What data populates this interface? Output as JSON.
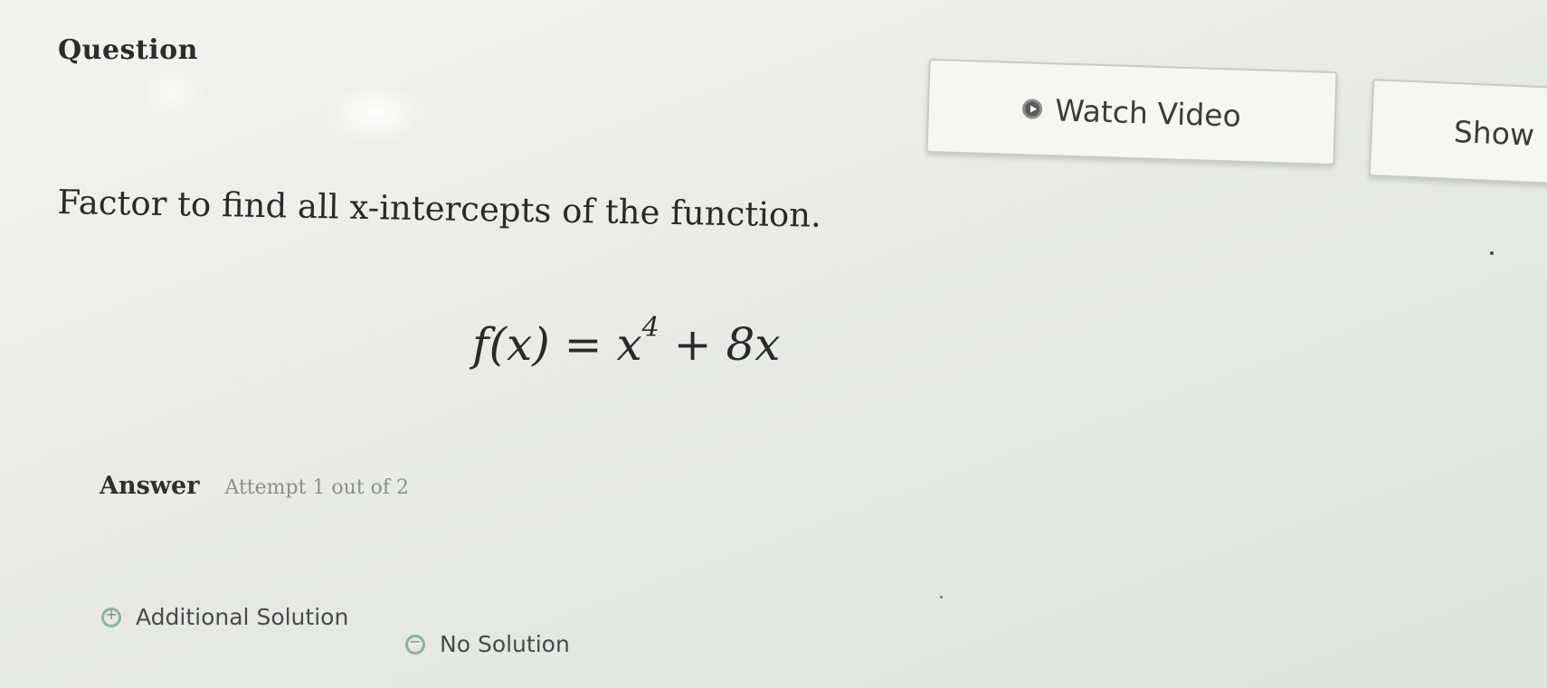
{
  "question": {
    "title": "Question",
    "prompt": "Factor to find all x-intercepts of the function.",
    "equation": {
      "lhs": "f(x)",
      "equals": "=",
      "term1_base": "x",
      "term1_exponent": "4",
      "plus": "+",
      "term2": "8x"
    }
  },
  "toolbar": {
    "watch_video_label": "Watch Video",
    "watch_video_icon": "play-circle-icon",
    "show_label": "Show"
  },
  "answer": {
    "label": "Answer",
    "attempt_text": "Attempt 1 out of 2"
  },
  "options": {
    "additional_solution_label": "Additional Solution",
    "additional_solution_icon": "plus-circle-icon",
    "no_solution_label": "No Solution",
    "no_solution_icon": "minus-circle-icon"
  },
  "colors": {
    "option_icon_accent": "#8fb39a",
    "text_primary": "#2a2a2a",
    "text_muted": "#8e908c"
  }
}
